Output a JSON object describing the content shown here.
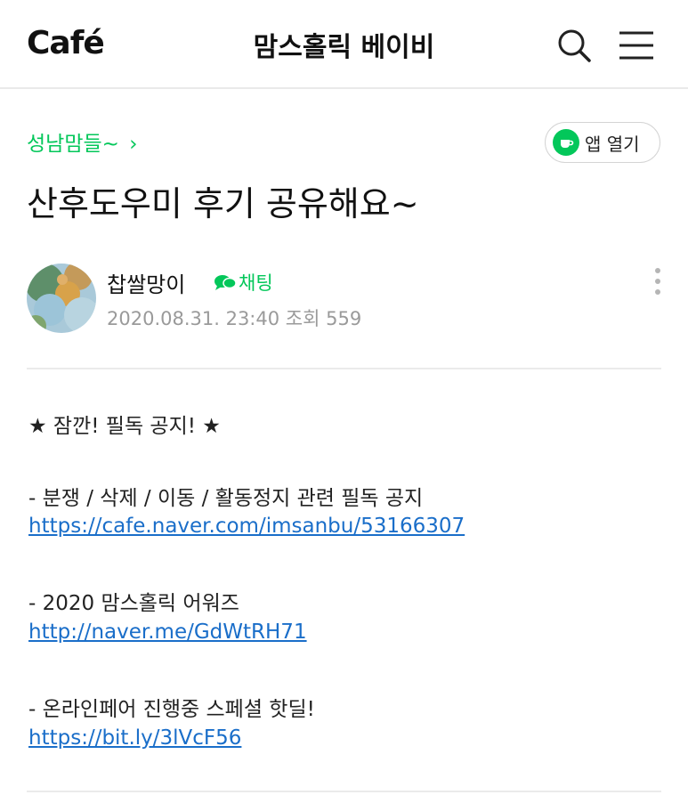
{
  "header": {
    "logo": "Café",
    "cafe_name": "맘스홀릭 베이비",
    "icons": [
      "search-icon",
      "hamburger-menu-icon"
    ]
  },
  "board": {
    "label": "성남맘들~",
    "arrow": "›"
  },
  "app_button": {
    "label": "앱 열기",
    "icon": "cafe-app-icon"
  },
  "post": {
    "title": "산후도우미 후기 공유해요~",
    "author": "찹쌀망이",
    "chat_label": "채팅",
    "meta": "2020.08.31. 23:40  조회 559",
    "body": {
      "notice": "★ 잠깐! 필독 공지! ★",
      "item1_text": "- 분쟁 / 삭제 / 이동 / 활동정지 관련 필독 공지",
      "item1_link": "https://cafe.naver.com/imsanbu/53166307",
      "item2_text": "- 2020 맘스홀릭 어워즈",
      "item2_link": "http://naver.me/GdWtRH71",
      "item3_text": "- 온라인페어 진행중 스페셜 핫딜!",
      "item3_link": "https://bit.ly/3lVcF56"
    }
  },
  "colors": {
    "accent": "#03c75a",
    "link": "#1a6ec9",
    "meta": "#9a9a9a"
  }
}
